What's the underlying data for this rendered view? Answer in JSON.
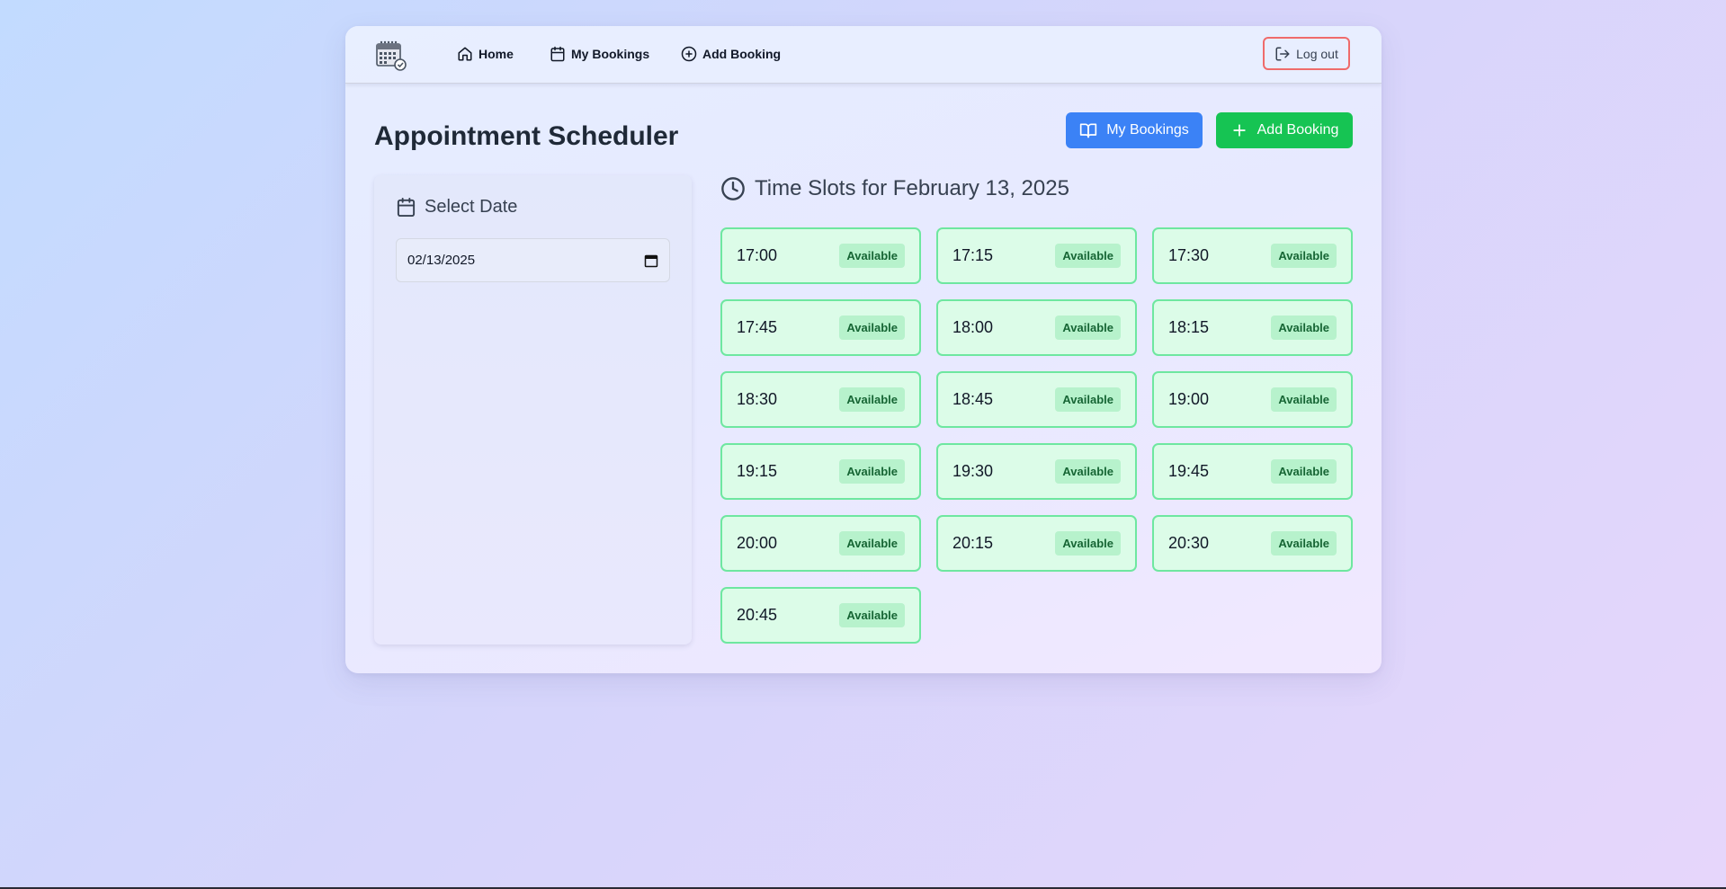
{
  "nav": {
    "home": "Home",
    "my_bookings": "My Bookings",
    "add_booking": "Add Booking",
    "logout": "Log out"
  },
  "header": {
    "title": "Appointment Scheduler",
    "my_bookings_button": "My Bookings",
    "add_booking_button": "Add Booking"
  },
  "date_panel": {
    "label": "Select Date",
    "value": "02/13/2025"
  },
  "slots": {
    "title": "Time Slots for February 13, 2025",
    "items": [
      {
        "time": "17:00",
        "status": "Available"
      },
      {
        "time": "17:15",
        "status": "Available"
      },
      {
        "time": "17:30",
        "status": "Available"
      },
      {
        "time": "17:45",
        "status": "Available"
      },
      {
        "time": "18:00",
        "status": "Available"
      },
      {
        "time": "18:15",
        "status": "Available"
      },
      {
        "time": "18:30",
        "status": "Available"
      },
      {
        "time": "18:45",
        "status": "Available"
      },
      {
        "time": "19:00",
        "status": "Available"
      },
      {
        "time": "19:15",
        "status": "Available"
      },
      {
        "time": "19:30",
        "status": "Available"
      },
      {
        "time": "19:45",
        "status": "Available"
      },
      {
        "time": "20:00",
        "status": "Available"
      },
      {
        "time": "20:15",
        "status": "Available"
      },
      {
        "time": "20:30",
        "status": "Available"
      },
      {
        "time": "20:45",
        "status": "Available"
      }
    ]
  },
  "colors": {
    "primary_blue": "#3b82f6",
    "success_green": "#16c453",
    "logout_border": "#ef6b6b",
    "slot_background": "#dcfce8",
    "slot_border": "#6ee7a0"
  }
}
